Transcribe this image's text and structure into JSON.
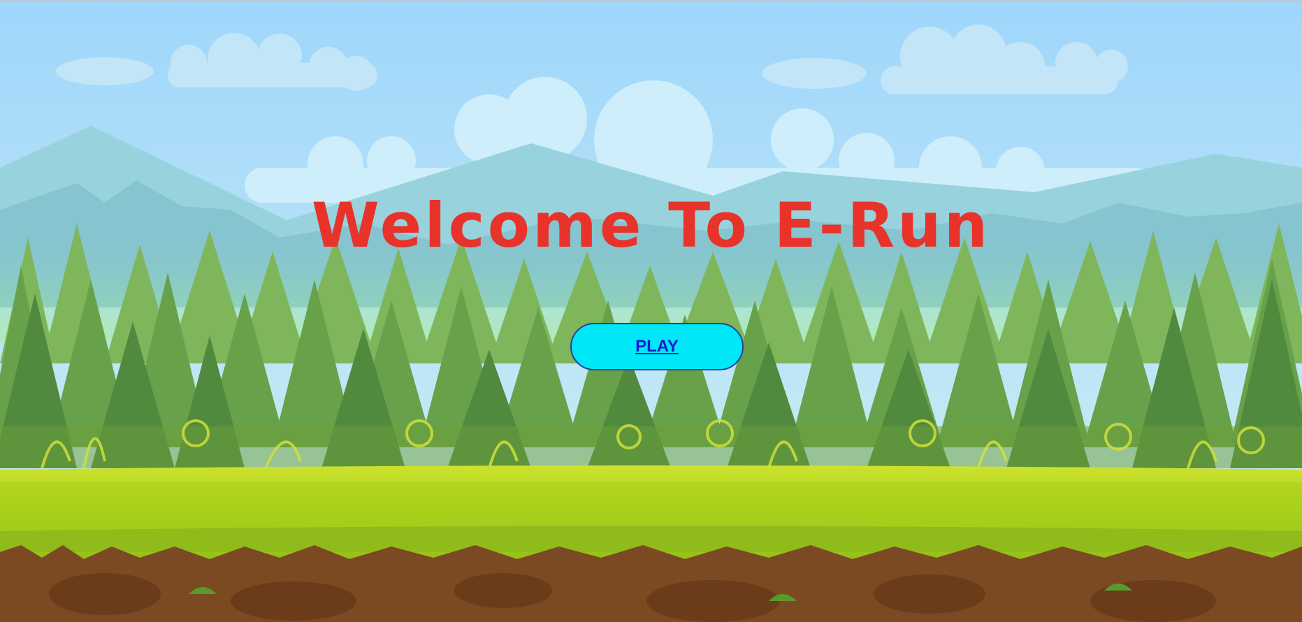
{
  "title": "Welcome To E-Run",
  "play_button": {
    "label": "PLAY"
  },
  "colors": {
    "title": "#e8332a",
    "play_button_bg": "#00e8f8",
    "play_link": "#1a1ad6",
    "sky": "#9fd8f8",
    "grass": "#a9d11d",
    "soil": "#7b4a22"
  },
  "scene": {
    "theme": "forest-background"
  }
}
